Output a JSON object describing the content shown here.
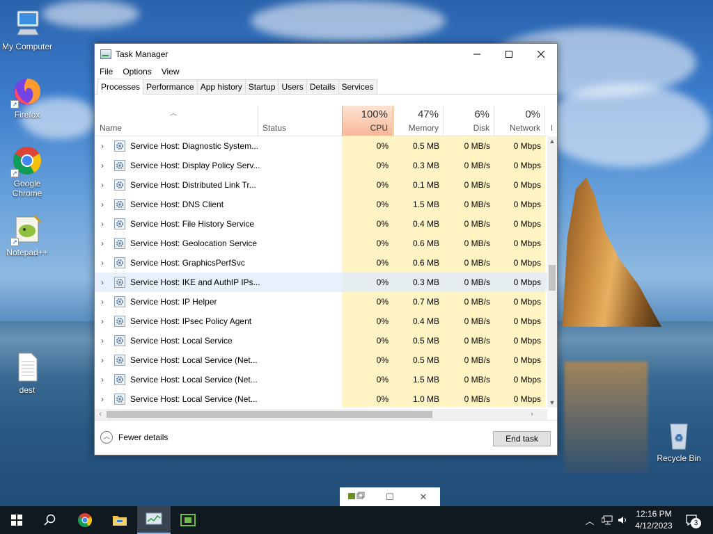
{
  "desktop": {
    "icons": [
      {
        "label": "My Computer"
      },
      {
        "label": "Firefox"
      },
      {
        "label": "Google Chrome"
      },
      {
        "label": "Notepad++"
      },
      {
        "label": "dest"
      },
      {
        "label": "Recycle Bin"
      }
    ]
  },
  "window": {
    "title": "Task Manager",
    "menu": [
      "File",
      "Options",
      "View"
    ],
    "tabs": [
      "Processes",
      "Performance",
      "App history",
      "Startup",
      "Users",
      "Details",
      "Services"
    ],
    "active_tab": "Processes",
    "columns": {
      "name": "Name",
      "status": "Status",
      "cpu": {
        "percent": "100%",
        "label": "CPU"
      },
      "memory": {
        "percent": "47%",
        "label": "Memory"
      },
      "disk": {
        "percent": "6%",
        "label": "Disk"
      },
      "network": {
        "percent": "0%",
        "label": "Network"
      },
      "overflow": "P"
    },
    "rows": [
      {
        "name": "Service Host: Diagnostic System...",
        "cpu": "0%",
        "memory": "0.5 MB",
        "disk": "0 MB/s",
        "network": "0 Mbps"
      },
      {
        "name": "Service Host: Display Policy Serv...",
        "cpu": "0%",
        "memory": "0.3 MB",
        "disk": "0 MB/s",
        "network": "0 Mbps"
      },
      {
        "name": "Service Host: Distributed Link Tr...",
        "cpu": "0%",
        "memory": "0.1 MB",
        "disk": "0 MB/s",
        "network": "0 Mbps"
      },
      {
        "name": "Service Host: DNS Client",
        "cpu": "0%",
        "memory": "1.5 MB",
        "disk": "0 MB/s",
        "network": "0 Mbps"
      },
      {
        "name": "Service Host: File History Service",
        "cpu": "0%",
        "memory": "0.4 MB",
        "disk": "0 MB/s",
        "network": "0 Mbps"
      },
      {
        "name": "Service Host: Geolocation Service",
        "cpu": "0%",
        "memory": "0.6 MB",
        "disk": "0 MB/s",
        "network": "0 Mbps"
      },
      {
        "name": "Service Host: GraphicsPerfSvc",
        "cpu": "0%",
        "memory": "0.6 MB",
        "disk": "0 MB/s",
        "network": "0 Mbps"
      },
      {
        "name": "Service Host: IKE and AuthIP IPs...",
        "cpu": "0%",
        "memory": "0.3 MB",
        "disk": "0 MB/s",
        "network": "0 Mbps"
      },
      {
        "name": "Service Host: IP Helper",
        "cpu": "0%",
        "memory": "0.7 MB",
        "disk": "0 MB/s",
        "network": "0 Mbps"
      },
      {
        "name": "Service Host: IPsec Policy Agent",
        "cpu": "0%",
        "memory": "0.4 MB",
        "disk": "0 MB/s",
        "network": "0 Mbps"
      },
      {
        "name": "Service Host: Local Service",
        "cpu": "0%",
        "memory": "0.5 MB",
        "disk": "0 MB/s",
        "network": "0 Mbps"
      },
      {
        "name": "Service Host: Local Service (Net...",
        "cpu": "0%",
        "memory": "0.5 MB",
        "disk": "0 MB/s",
        "network": "0 Mbps"
      },
      {
        "name": "Service Host: Local Service (Net...",
        "cpu": "0%",
        "memory": "1.5 MB",
        "disk": "0 MB/s",
        "network": "0 Mbps"
      },
      {
        "name": "Service Host: Local Service (Net...",
        "cpu": "0%",
        "memory": "1.0 MB",
        "disk": "0 MB/s",
        "network": "0 Mbps"
      }
    ],
    "highlighted_row": 7,
    "footer": {
      "fewer_details": "Fewer details",
      "end_task": "End task"
    }
  },
  "taskbar": {
    "clock_time": "12:16 PM",
    "clock_date": "4/12/2023",
    "notification_count": "3"
  },
  "colors": {
    "accent_cpu_header": "#fbc8a8",
    "cell_heat": "#fff4c4",
    "row_highlight": "#e8f1fb",
    "taskbar": "#101820"
  }
}
